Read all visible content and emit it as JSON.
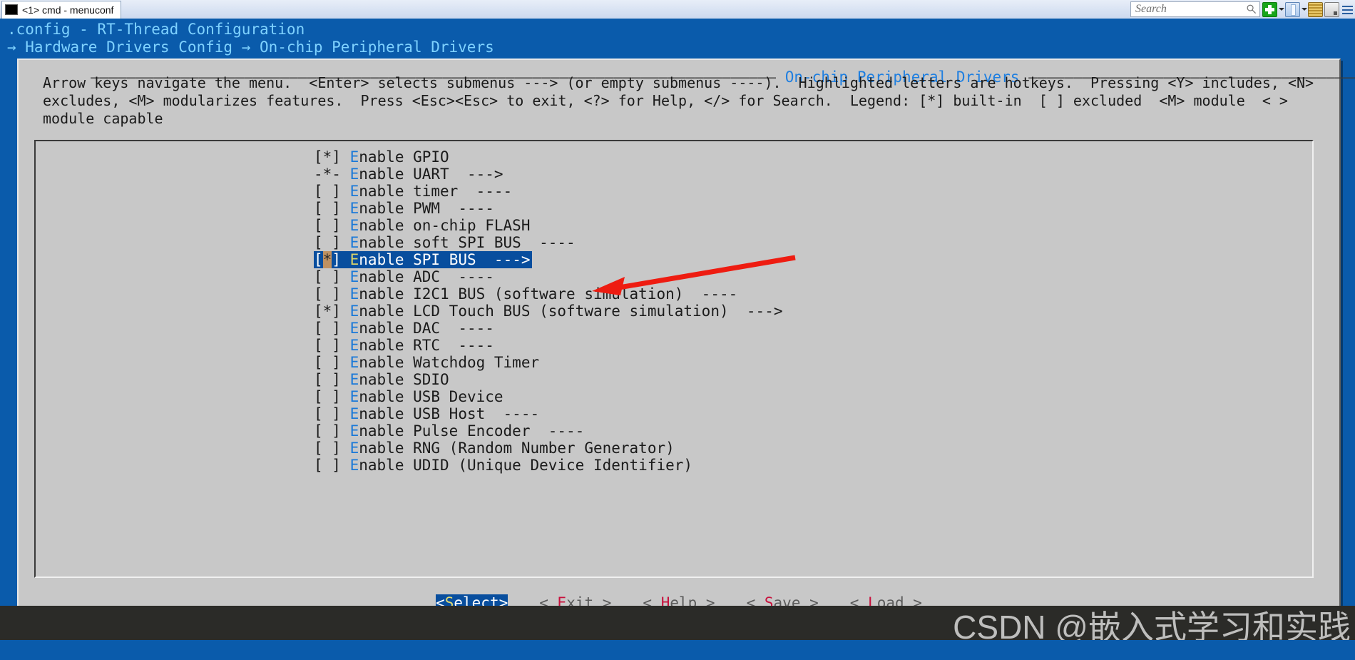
{
  "window": {
    "tab_label": "<1> cmd - menuconf",
    "tab_icon": "console-icon",
    "search_placeholder": "Search",
    "toolbar_icons": [
      "new-tab-icon",
      "chevron-down-icon",
      "split-pane-icon",
      "chevron-down-icon",
      "tabs-stack-icon",
      "save-icon",
      "menu-icon"
    ]
  },
  "menuconfig": {
    "header_title": ".config - RT-Thread Configuration",
    "breadcrumb": "→ Hardware Drivers Config → On-chip Peripheral Drivers",
    "dialog_title": "On-chip Peripheral Drivers",
    "help_text": "Arrow keys navigate the menu.  <Enter> selects submenus ---> (or empty submenus ----).  Highlighted letters are hotkeys.  Pressing <Y> includes, <N> excludes, <M> modularizes features.  Press <Esc><Esc> to exit, <?> for Help, </> for Search.  Legend: [*] built-in  [ ] excluded  <M> module  < > module capable",
    "items": [
      {
        "mark": "[*]",
        "hotkey": "E",
        "label": "nable GPIO",
        "suffix": "",
        "selected": false
      },
      {
        "mark": "-*-",
        "hotkey": "E",
        "label": "nable UART",
        "suffix": "  --->",
        "selected": false
      },
      {
        "mark": "[ ]",
        "hotkey": "E",
        "label": "nable timer",
        "suffix": "  ----",
        "selected": false
      },
      {
        "mark": "[ ]",
        "hotkey": "E",
        "label": "nable PWM",
        "suffix": "  ----",
        "selected": false
      },
      {
        "mark": "[ ]",
        "hotkey": "E",
        "label": "nable on-chip FLASH",
        "suffix": "",
        "selected": false
      },
      {
        "mark": "[ ]",
        "hotkey": "E",
        "label": "nable soft SPI BUS",
        "suffix": "  ----",
        "selected": false
      },
      {
        "mark": "[*]",
        "hotkey": "E",
        "label": "nable SPI BUS",
        "suffix": "  --->",
        "selected": true
      },
      {
        "mark": "[ ]",
        "hotkey": "E",
        "label": "nable ADC",
        "suffix": "  ----",
        "selected": false
      },
      {
        "mark": "[ ]",
        "hotkey": "E",
        "label": "nable I2C1 BUS (software simulation)",
        "suffix": "  ----",
        "selected": false
      },
      {
        "mark": "[*]",
        "hotkey": "E",
        "label": "nable LCD Touch BUS (software simulation)",
        "suffix": "  --->",
        "selected": false
      },
      {
        "mark": "[ ]",
        "hotkey": "E",
        "label": "nable DAC",
        "suffix": "  ----",
        "selected": false
      },
      {
        "mark": "[ ]",
        "hotkey": "E",
        "label": "nable RTC",
        "suffix": "  ----",
        "selected": false
      },
      {
        "mark": "[ ]",
        "hotkey": "E",
        "label": "nable Watchdog Timer",
        "suffix": "",
        "selected": false
      },
      {
        "mark": "[ ]",
        "hotkey": "E",
        "label": "nable SDIO",
        "suffix": "",
        "selected": false
      },
      {
        "mark": "[ ]",
        "hotkey": "E",
        "label": "nable USB Device",
        "suffix": "",
        "selected": false
      },
      {
        "mark": "[ ]",
        "hotkey": "E",
        "label": "nable USB Host",
        "suffix": "  ----",
        "selected": false
      },
      {
        "mark": "[ ]",
        "hotkey": "E",
        "label": "nable Pulse Encoder",
        "suffix": "  ----",
        "selected": false
      },
      {
        "mark": "[ ]",
        "hotkey": "E",
        "label": "nable RNG (Random Number Generator)",
        "suffix": "",
        "selected": false
      },
      {
        "mark": "[ ]",
        "hotkey": "E",
        "label": "nable UDID (Unique Device Identifier)",
        "suffix": "",
        "selected": false
      }
    ],
    "buttons": [
      {
        "pre": "<",
        "hotkey": "S",
        "rest": "elect>",
        "post": "",
        "selected": true
      },
      {
        "pre": "< ",
        "hotkey": "E",
        "rest": "xit",
        "post": " >",
        "selected": false
      },
      {
        "pre": "< ",
        "hotkey": "H",
        "rest": "elp",
        "post": " >",
        "selected": false
      },
      {
        "pre": "< ",
        "hotkey": "S",
        "rest": "ave",
        "post": " >",
        "selected": false
      },
      {
        "pre": "< ",
        "hotkey": "L",
        "rest": "oad",
        "post": " >",
        "selected": false
      }
    ]
  },
  "annotation": {
    "arrow_color": "#ee1c11",
    "arrow_name": "red-pointer-arrow"
  },
  "watermark": {
    "text": "CSDN @嵌入式学习和实践"
  },
  "colors": {
    "terminal_blue": "#0a5bab",
    "dialog_gray": "#c8c8c8",
    "select_blue": "#084e9e",
    "hotkey_blue": "#1a79d8",
    "hotkey_red": "#c8103c",
    "cursor_tan": "#bf9161",
    "title_blue": "#1f7fe0"
  }
}
